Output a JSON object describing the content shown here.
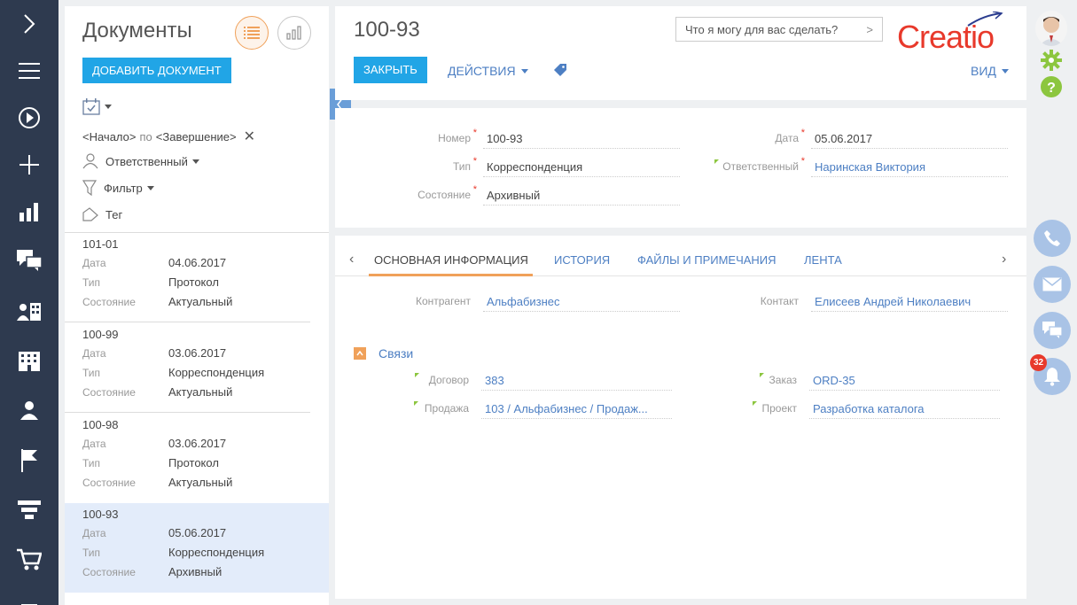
{
  "colors": {
    "nav_bg": "#2e3a4f",
    "accent_blue": "#21a5e6",
    "link_blue": "#4d7fc3",
    "orange": "#f0a15a",
    "logo_red": "#e8392b",
    "green": "#8cc63f"
  },
  "nav": {
    "icons": [
      "chevron-right-icon",
      "menu-icon",
      "play-icon",
      "plus-icon",
      "chart-icon",
      "chat-icon",
      "accounts-icon",
      "building-icon",
      "contact-icon",
      "flag-icon",
      "funnel-icon",
      "cart-icon",
      "document-icon"
    ]
  },
  "list": {
    "title": "Документы",
    "add_label": "ДОБАВИТЬ ДОКУМЕНТ",
    "period": {
      "start": "<Начало>",
      "sep": "по",
      "end": "<Завершение>"
    },
    "owner_filter": "Ответственный",
    "filter_label": "Фильтр",
    "tag_label": "Тег",
    "field_labels": {
      "date": "Дата",
      "type": "Тип",
      "state": "Состояние"
    },
    "records": [
      {
        "number": "101-01",
        "date": "04.06.2017",
        "type": "Протокол",
        "state": "Актуальный",
        "selected": false
      },
      {
        "number": "100-99",
        "date": "03.06.2017",
        "type": "Корреспонденция",
        "state": "Актуальный",
        "selected": false
      },
      {
        "number": "100-98",
        "date": "03.06.2017",
        "type": "Протокол",
        "state": "Актуальный",
        "selected": false
      },
      {
        "number": "100-93",
        "date": "05.06.2017",
        "type": "Корреспонденция",
        "state": "Архивный",
        "selected": true
      }
    ]
  },
  "header": {
    "title": "100-93",
    "ask_placeholder": "Что я могу для вас сделать?",
    "ask_chevron": ">",
    "logo_text": "Creatio",
    "close_label": "ЗАКРЫТЬ",
    "actions_label": "ДЕЙСТВИЯ",
    "view_label": "ВИД"
  },
  "fields": {
    "number": {
      "label": "Номер",
      "value": "100-93"
    },
    "type": {
      "label": "Тип",
      "value": "Корреспонденция"
    },
    "state": {
      "label": "Состояние",
      "value": "Архивный"
    },
    "date": {
      "label": "Дата",
      "value": "05.06.2017"
    },
    "owner": {
      "label": "Ответственный",
      "value": "Наринская Виктория"
    }
  },
  "tabs": {
    "items": [
      "ОСНОВНАЯ ИНФОРМАЦИЯ",
      "ИСТОРИЯ",
      "ФАЙЛЫ И ПРИМЕЧАНИЯ",
      "ЛЕНТА"
    ],
    "active": "ОСНОВНАЯ ИНФОРМАЦИЯ",
    "prev": "‹",
    "next": "›"
  },
  "main_info": {
    "account": {
      "label": "Контрагент",
      "value": "Альфабизнес"
    },
    "contact": {
      "label": "Контакт",
      "value": "Елисеев Андрей Николаевич"
    },
    "section_title": "Связи",
    "contract": {
      "label": "Договор",
      "value": "383"
    },
    "order": {
      "label": "Заказ",
      "value": "ORD-35"
    },
    "opportunity": {
      "label": "Продажа",
      "value": "103 / Альфабизнес / Продаж..."
    },
    "project": {
      "label": "Проект",
      "value": "Разработка каталога"
    }
  },
  "rail": {
    "notifications_count": "32"
  }
}
